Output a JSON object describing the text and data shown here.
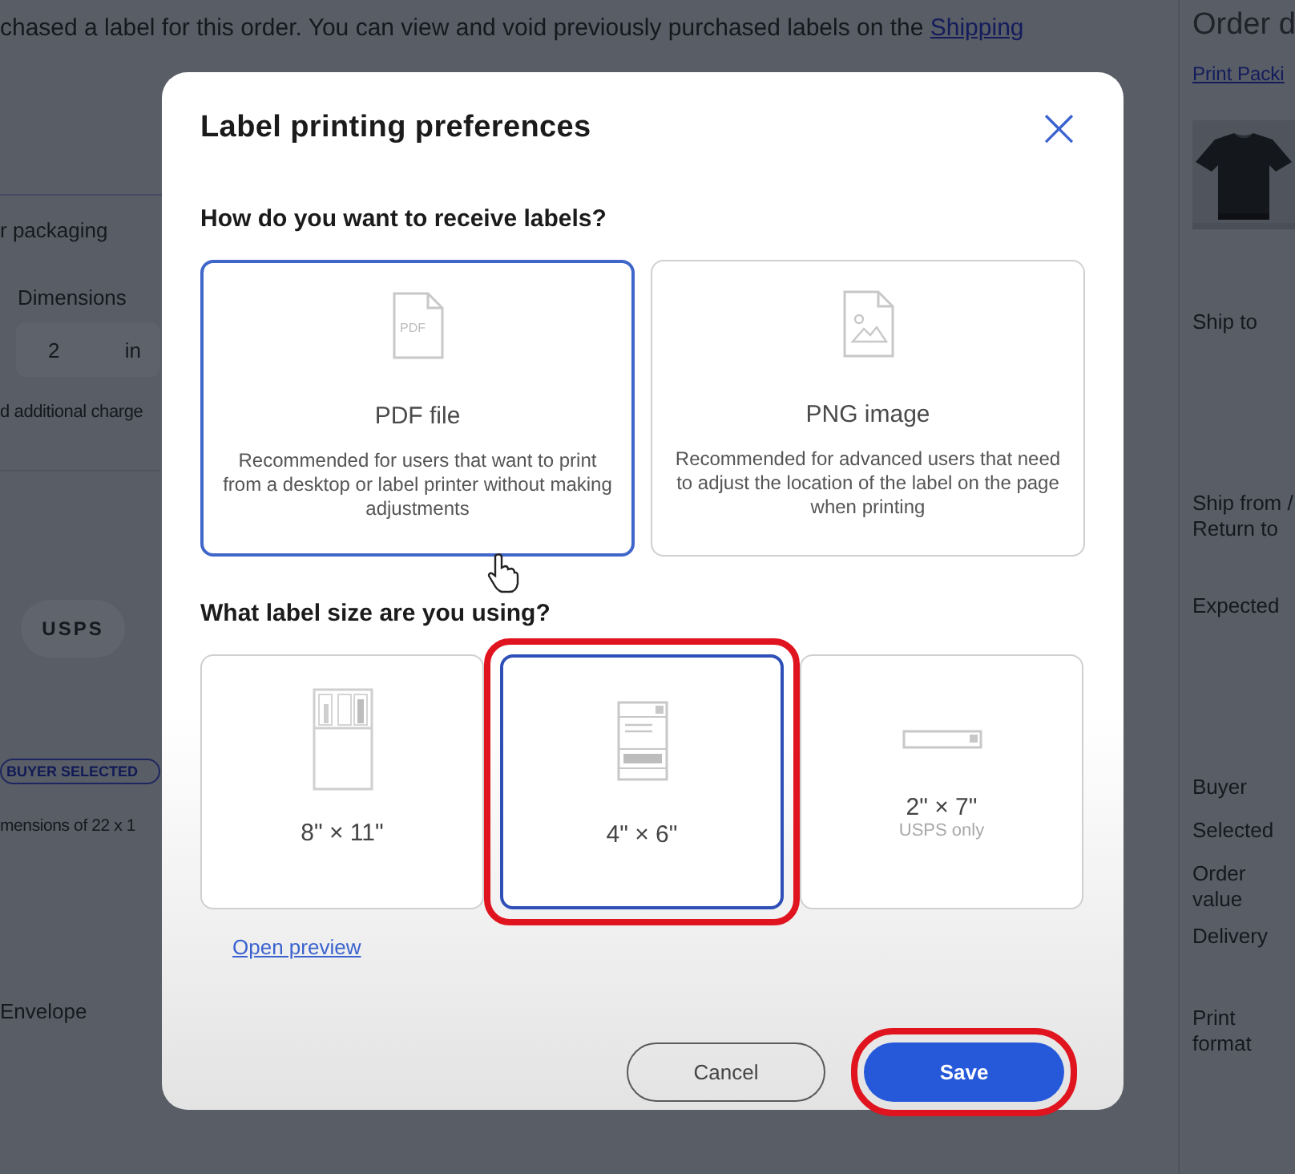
{
  "background": {
    "notice": "chased a label for this order. You can view and void previously purchased labels on the ",
    "notice_link": "Shipping",
    "packaging_label": "r packaging",
    "dimensions_label": "Dimensions",
    "dimension_value": "2",
    "dimension_unit": "in",
    "charges_note": "d additional charge",
    "carriers": [
      {
        "label": "USPS"
      }
    ],
    "badge": "BUYER SELECTED",
    "dimensions_note": "mensions of 22 x 1",
    "package_type": "Envelope"
  },
  "order_panel": {
    "title": "Order d",
    "link": "Print Packi",
    "fields": [
      "Ship to",
      "Ship from / Return to",
      "Expected",
      "Buyer",
      "Selected",
      "Order value",
      "Delivery",
      "Print format"
    ]
  },
  "dialog": {
    "title": "Label printing preferences",
    "close": "×",
    "format_question": "How do you want to receive labels?",
    "formats": [
      {
        "kind": "pdf",
        "icon_text": "PDF",
        "name": "PDF file",
        "description": "Recommended for users that want to print from a desktop or label printer without making adjustments",
        "selected": true
      },
      {
        "kind": "png",
        "name": "PNG image",
        "description": "Recommended for advanced users that need to adjust the location of the label on the page when printing",
        "selected": false
      }
    ],
    "size_question": "What label size are you using?",
    "sizes": [
      {
        "kind": "letter",
        "name": "8\" × 11\"",
        "selected": false,
        "highlighted": false
      },
      {
        "kind": "fourbysix",
        "name": "4\" × 6\"",
        "selected": true,
        "highlighted": true
      },
      {
        "kind": "twobyseven",
        "name": "2\" × 7\"",
        "note": "USPS only",
        "selected": false,
        "highlighted": false
      }
    ],
    "preview_link": "Open preview",
    "buttons": [
      {
        "kind": "secondary",
        "label": "Cancel",
        "highlighted": false
      },
      {
        "kind": "primary",
        "label": "Save",
        "highlighted": true
      }
    ]
  }
}
